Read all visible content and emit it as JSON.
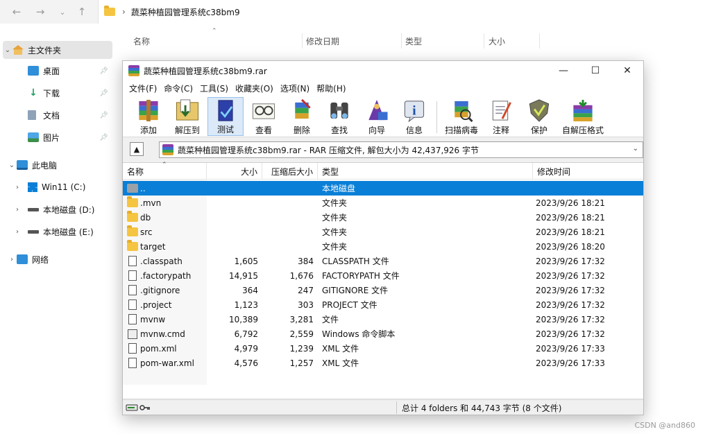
{
  "explorer": {
    "address_path": "蔬菜种植园管理系统c38bm9",
    "nav": [
      {
        "label": "主文件夹",
        "icon": "home-icon",
        "pinned": false,
        "selected": true
      },
      {
        "label": "桌面",
        "icon": "desktop-icon",
        "pinned": true
      },
      {
        "label": "下载",
        "icon": "download-icon",
        "pinned": true
      },
      {
        "label": "文档",
        "icon": "document-icon",
        "pinned": true
      },
      {
        "label": "图片",
        "icon": "picture-icon",
        "pinned": true
      },
      {
        "label": "此电脑",
        "icon": "computer-icon",
        "pinned": false
      },
      {
        "label": "Win11 (C:)",
        "icon": "windows-drive-icon",
        "pinned": false
      },
      {
        "label": "本地磁盘 (D:)",
        "icon": "drive-icon",
        "pinned": false
      },
      {
        "label": "本地磁盘 (E:)",
        "icon": "drive-icon",
        "pinned": false
      },
      {
        "label": "网络",
        "icon": "network-icon",
        "pinned": false
      }
    ],
    "columns": [
      "名称",
      "修改日期",
      "类型",
      "大小"
    ]
  },
  "winrar": {
    "title": "蔬菜种植园管理系统c38bm9.rar",
    "menu": [
      "文件(F)",
      "命令(C)",
      "工具(S)",
      "收藏夹(O)",
      "选项(N)",
      "帮助(H)"
    ],
    "toolbar": [
      {
        "label": "添加",
        "icon": "add-icon"
      },
      {
        "label": "解压到",
        "icon": "extract-icon"
      },
      {
        "label": "测试",
        "icon": "test-icon",
        "selected": true
      },
      {
        "label": "查看",
        "icon": "view-icon"
      },
      {
        "label": "删除",
        "icon": "delete-icon"
      },
      {
        "label": "查找",
        "icon": "find-icon"
      },
      {
        "label": "向导",
        "icon": "wizard-icon"
      },
      {
        "label": "信息",
        "icon": "info-icon"
      },
      {
        "label": "扫描病毒",
        "icon": "virus-scan-icon"
      },
      {
        "label": "注释",
        "icon": "comment-icon"
      },
      {
        "label": "保护",
        "icon": "protect-icon"
      },
      {
        "label": "自解压格式",
        "icon": "sfx-icon"
      }
    ],
    "path_text": "蔬菜种植园管理系统c38bm9.rar - RAR 压缩文件, 解包大小为 42,437,926 字节",
    "columns": [
      "名称",
      "大小",
      "压缩后大小",
      "类型",
      "修改时间"
    ],
    "rows": [
      {
        "name": "..",
        "size": "",
        "packed": "",
        "type": "本地磁盘",
        "modified": "",
        "icon": "up",
        "selected": true
      },
      {
        "name": ".mvn",
        "size": "",
        "packed": "",
        "type": "文件夹",
        "modified": "2023/9/26 18:21",
        "icon": "folder"
      },
      {
        "name": "db",
        "size": "",
        "packed": "",
        "type": "文件夹",
        "modified": "2023/9/26 18:21",
        "icon": "folder"
      },
      {
        "name": "src",
        "size": "",
        "packed": "",
        "type": "文件夹",
        "modified": "2023/9/26 18:21",
        "icon": "folder"
      },
      {
        "name": "target",
        "size": "",
        "packed": "",
        "type": "文件夹",
        "modified": "2023/9/26 18:20",
        "icon": "folder"
      },
      {
        "name": ".classpath",
        "size": "1,605",
        "packed": "384",
        "type": "CLASSPATH 文件",
        "modified": "2023/9/26 17:32",
        "icon": "file"
      },
      {
        "name": ".factorypath",
        "size": "14,915",
        "packed": "1,676",
        "type": "FACTORYPATH 文件",
        "modified": "2023/9/26 17:32",
        "icon": "file"
      },
      {
        "name": ".gitignore",
        "size": "364",
        "packed": "247",
        "type": "GITIGNORE 文件",
        "modified": "2023/9/26 17:32",
        "icon": "file"
      },
      {
        "name": ".project",
        "size": "1,123",
        "packed": "303",
        "type": "PROJECT 文件",
        "modified": "2023/9/26 17:32",
        "icon": "file"
      },
      {
        "name": "mvnw",
        "size": "10,389",
        "packed": "3,281",
        "type": "文件",
        "modified": "2023/9/26 17:32",
        "icon": "file"
      },
      {
        "name": "mvnw.cmd",
        "size": "6,792",
        "packed": "2,559",
        "type": "Windows 命令脚本",
        "modified": "2023/9/26 17:32",
        "icon": "cmd"
      },
      {
        "name": "pom.xml",
        "size": "4,979",
        "packed": "1,239",
        "type": "XML 文件",
        "modified": "2023/9/26 17:33",
        "icon": "file"
      },
      {
        "name": "pom-war.xml",
        "size": "4,576",
        "packed": "1,257",
        "type": "XML 文件",
        "modified": "2023/9/26 17:33",
        "icon": "file"
      }
    ],
    "status": "总计 4 folders 和 44,743 字节 (8 个文件)"
  },
  "watermark": "CSDN @and860",
  "colors": {
    "selection": "#0a7fd7",
    "folder": "#f5c542"
  }
}
